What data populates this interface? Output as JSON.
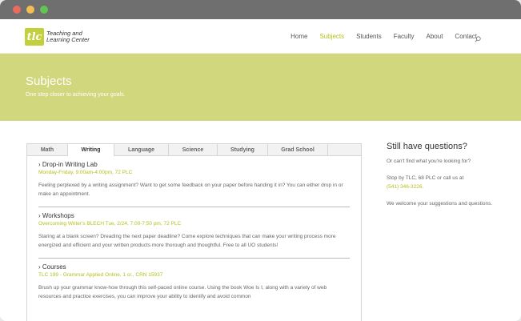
{
  "window": {
    "controls": {
      "close_color": "#ec6a5e",
      "minimize_color": "#f4bf4f",
      "zoom_color": "#61c554"
    }
  },
  "header": {
    "logo_mark": "tlc",
    "logo_text_line1": "Teaching and",
    "logo_text_line2": "Learning Center",
    "nav": [
      {
        "label": "Home",
        "active": false
      },
      {
        "label": "Subjects",
        "active": true
      },
      {
        "label": "Students",
        "active": false
      },
      {
        "label": "Faculty",
        "active": false
      },
      {
        "label": "About",
        "active": false
      },
      {
        "label": "Contact",
        "active": false
      }
    ],
    "search_icon": "search-icon"
  },
  "hero": {
    "title": "Subjects",
    "subtitle": "One step closer to achieving your goals."
  },
  "tabs": [
    "Math",
    "Writing",
    "Language",
    "Science",
    "Studying",
    "Grad School"
  ],
  "active_tab": "Writing",
  "sections": [
    {
      "title": "› Drop-in Writing Lab",
      "meta": "Monday-Friday, 9:00am-4:00pm, 72 PLC",
      "desc": "Feeling perplexed by a writing assignment? Want to get some feedback on your paper before handing it in? You can either drop in or make an appointment."
    },
    {
      "title": "› Workshops",
      "meta": "Overcoming Writer's BLECH Tue, 2/24, 7:00-7:50 pm, 72 PLC",
      "desc": "Staring at a blank screen? Dreading the next paper deadline? Come explore techniques that can make your writing process more energized and efficient and your written products more thorough and thoughtful. Free to all UO students!"
    },
    {
      "title": "› Courses",
      "meta": "TLC 199 - Grammar Applied Online, 1 cr., CRN 15937",
      "desc": "Brush up your grammar know-how through this self-paced online course. Using the book Woe Is I, along with a variety of web resources and practice exercises, you can improve your ability to identify and avoid common"
    }
  ],
  "sidebar": {
    "title": "Still have questions?",
    "p1": "Or can't find what you're looking for?",
    "p2_prefix": "Stop by TLC, 68 PLC or call us at",
    "phone": "(541) 346-3226.",
    "p3": "We welcome your suggestions and questions."
  },
  "colors": {
    "accent": "#b3c21a",
    "hero_bg": "#d0d77c",
    "logo_bg": "#c3cf3c"
  }
}
